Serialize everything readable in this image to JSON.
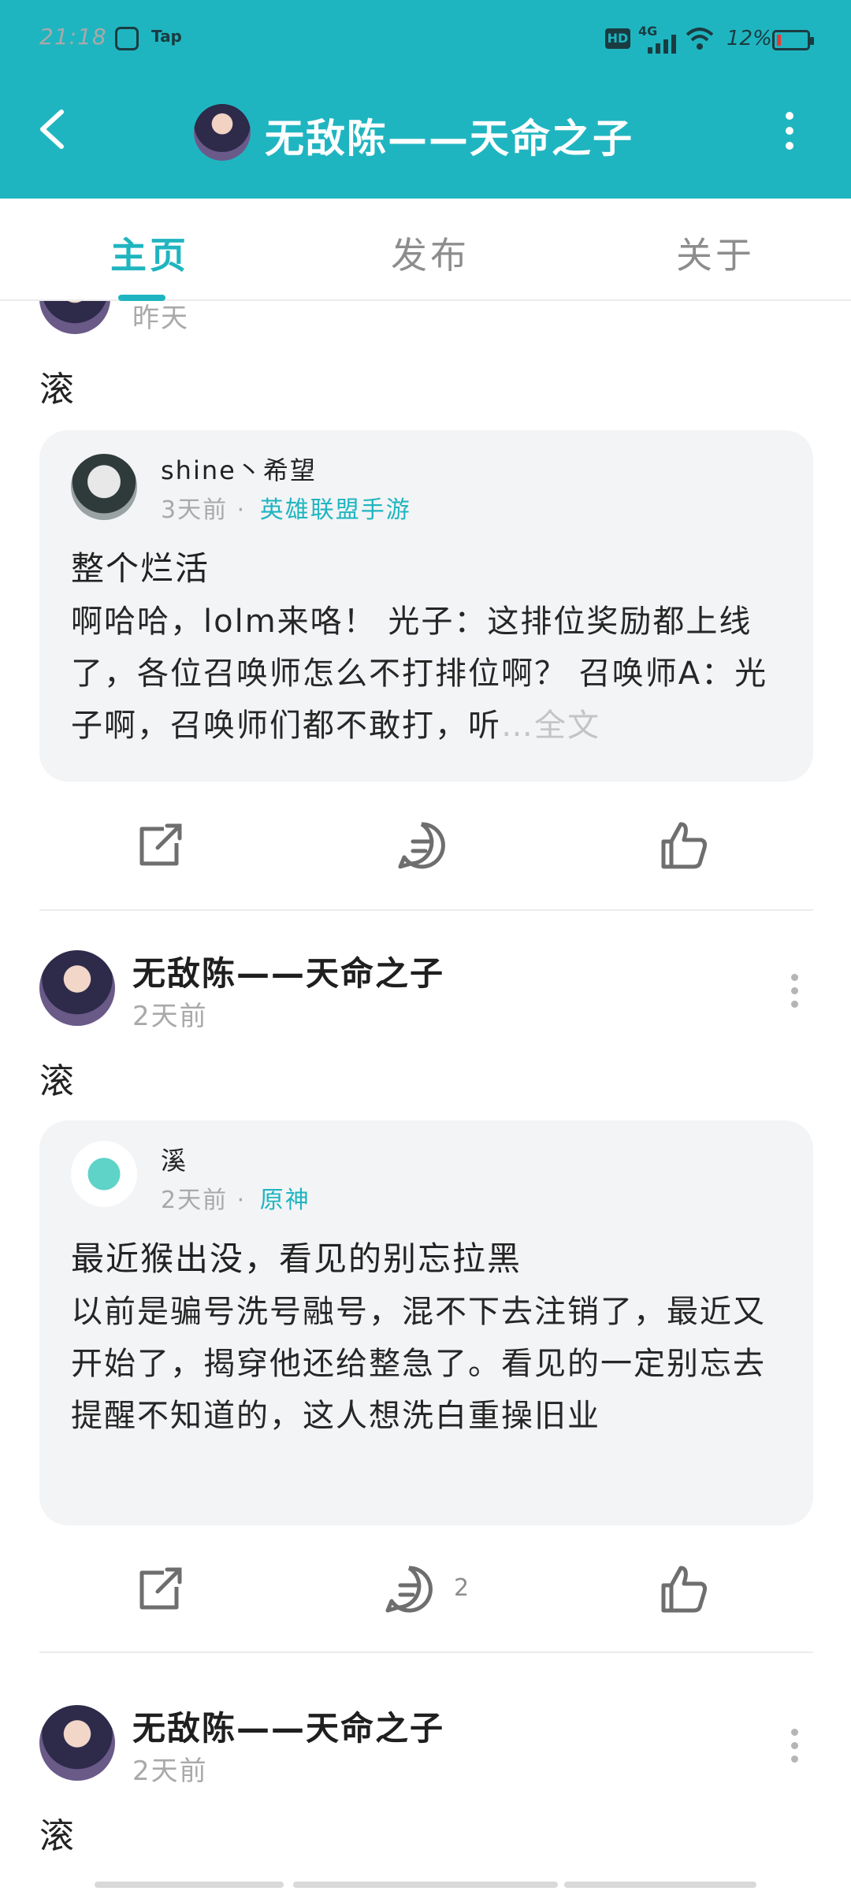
{
  "status_bar": {
    "time": "21:18",
    "app_label": "Tap",
    "hd": "HD",
    "network": "4G",
    "battery": "12%"
  },
  "header": {
    "title": "无敌陈——天命之子",
    "back_icon": "arrow-left-icon",
    "more_icon": "more-vertical-icon"
  },
  "tabs": [
    {
      "label": "主页",
      "active": true
    },
    {
      "label": "发布",
      "active": false
    },
    {
      "label": "关于",
      "active": false
    }
  ],
  "posts": [
    {
      "time": "昨天",
      "text": "滚",
      "card": {
        "author": "shine丶希望",
        "time": "3天前",
        "game": "英雄联盟手游",
        "title": "整个烂活",
        "body": "啊哈哈，lolm来咯！ 光子：这排位奖励都上线了，各位召唤师怎么不打排位啊？ 召唤师A：光子啊，召唤师们都不敢打，听",
        "expand": "…全文"
      },
      "comments": ""
    },
    {
      "author": "无敌陈——天命之子",
      "time": "2天前",
      "text": "滚",
      "card": {
        "author": "溪",
        "time": "2天前",
        "game": "原神",
        "title": "最近猴出没，看见的别忘拉黑",
        "body": "以前是骗号洗号融号，混不下去注销了，最近又开始了，揭穿他还给整急了。看见的一定别忘去提醒不知道的，这人想洗白重操旧业"
      },
      "comments": "2"
    },
    {
      "author": "无敌陈——天命之子",
      "time": "2天前",
      "text": "滚"
    }
  ],
  "colors": {
    "accent": "#1fb5c0",
    "card_bg": "#f3f4f6"
  }
}
